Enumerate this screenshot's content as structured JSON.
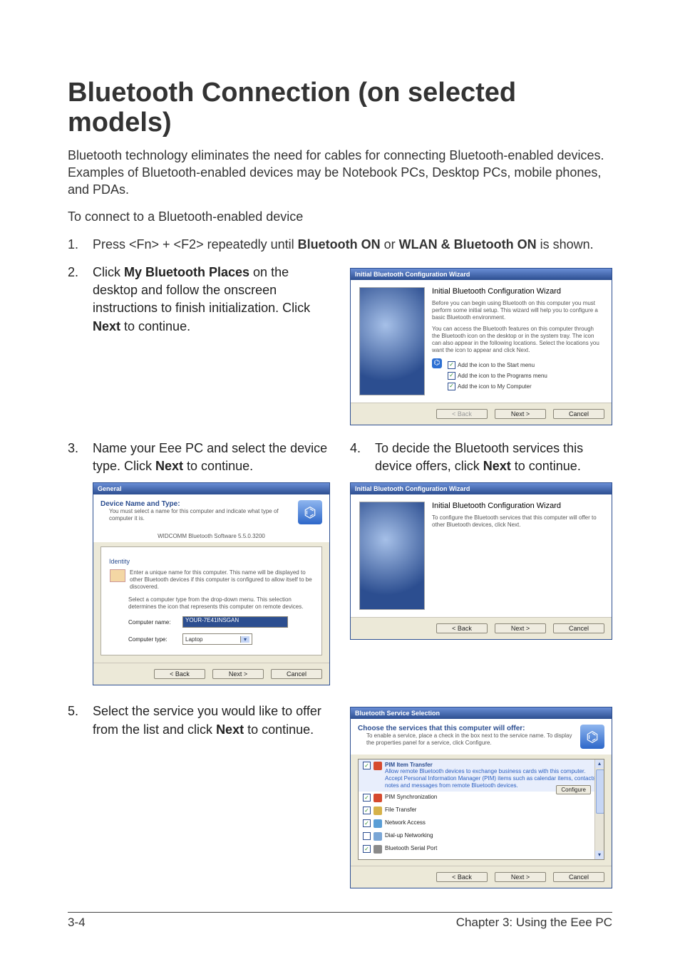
{
  "title": "Bluetooth Connection (on selected models)",
  "intro": "Bluetooth technology eliminates the need for cables for connecting Bluetooth-enabled devices. Examples of Bluetooth-enabled devices may be Notebook PCs, Desktop PCs, mobile phones, and PDAs.",
  "lead": "To connect to a Bluetooth-enabled device",
  "step1_num": "1.",
  "step1_a": "Press <Fn> + <F2> repeatedly until ",
  "step1_b1": "Bluetooth ON",
  "step1_c": " or ",
  "step1_b2": "WLAN & Bluetooth ON",
  "step1_d": " is shown.",
  "step2_num": "2.",
  "step2_a": "Click ",
  "step2_b": "My Bluetooth Places",
  "step2_c": " on the desktop and follow the onscreen instructions to finish initialization. Click ",
  "step2_d": "Next",
  "step2_e": " to continue.",
  "step3_num": "3.",
  "step3_a": "Name your Eee PC and select the device type. Click ",
  "step3_b": "Next",
  "step3_c": " to continue.",
  "step4_num": "4.",
  "step4_a": "To decide the Bluetooth services this device offers, click ",
  "step4_b": "Next",
  "step4_c": " to continue.",
  "step5_num": "5.",
  "step5_a": "Select the service you would like to offer from the list and click ",
  "step5_b": "Next",
  "step5_c": " to continue.",
  "wiz1": {
    "titlebar": "Initial Bluetooth Configuration Wizard",
    "heading": "Initial Bluetooth Configuration Wizard",
    "p1": "Before you can begin using Bluetooth on this computer you must perform some initial setup. This wizard will help you to configure a basic Bluetooth environment.",
    "p2": "You can access the Bluetooth features on this computer through the Bluetooth icon on the desktop or in the system tray. The icon can also appear in the following locations. Select the locations you want the icon to appear and click Next.",
    "cb1": "Add the icon to the Start menu",
    "cb2": "Add the icon to the Programs menu",
    "cb3": "Add the icon to My Computer"
  },
  "wiz2": {
    "titlebar": "Initial Bluetooth Configuration Wizard",
    "heading": "Initial Bluetooth Configuration Wizard",
    "p1": "To configure the Bluetooth services that this computer will offer to other Bluetooth devices, click Next."
  },
  "general": {
    "titlebar": "General",
    "headline": "Device Name and Type:",
    "sub": "You must select a name for this computer and indicate what type of computer it is.",
    "version": "WIDCOMM Bluetooth Software 5.5.0.3200",
    "group": "Identity",
    "desc1": "Enter a unique name for this computer. This name will be displayed to other Bluetooth devices if this computer is configured to allow itself to be discovered.",
    "desc2": "Select a computer type from the drop-down menu. This selection determines the icon that represents this computer on remote devices.",
    "name_label": "Computer name:",
    "name_value": "YOUR-7E41INSGAN",
    "type_label": "Computer type:",
    "type_value": "Laptop"
  },
  "svc": {
    "titlebar": "Bluetooth Service Selection",
    "headline": "Choose the services that this computer will offer:",
    "sub": "To enable a service, place a check in the box next to the service name. To display the properties panel for a service, click Configure.",
    "configure": "Configure",
    "items": [
      {
        "label": "PIM Item Transfer",
        "checked": true,
        "selected": true,
        "color": "#d64a2e",
        "desc": "Allow remote Bluetooth devices to exchange business cards with this computer. Accept Personal Information Manager (PIM) items such as calendar items, contacts, notes and messages from remote Bluetooth devices."
      },
      {
        "label": "PIM Synchronization",
        "checked": true,
        "selected": false,
        "color": "#d64a2e"
      },
      {
        "label": "File Transfer",
        "checked": true,
        "selected": false,
        "color": "#d6b24a"
      },
      {
        "label": "Network Access",
        "checked": true,
        "selected": false,
        "color": "#5a9ed6"
      },
      {
        "label": "Dial-up Networking",
        "checked": false,
        "selected": false,
        "color": "#7aa6d6"
      },
      {
        "label": "Bluetooth Serial Port",
        "checked": true,
        "selected": false,
        "color": "#8a8a8a"
      }
    ]
  },
  "buttons": {
    "back": "< Back",
    "next": "Next >",
    "cancel": "Cancel"
  },
  "footer": {
    "left": "3-4",
    "right": "Chapter 3: Using the Eee PC"
  }
}
